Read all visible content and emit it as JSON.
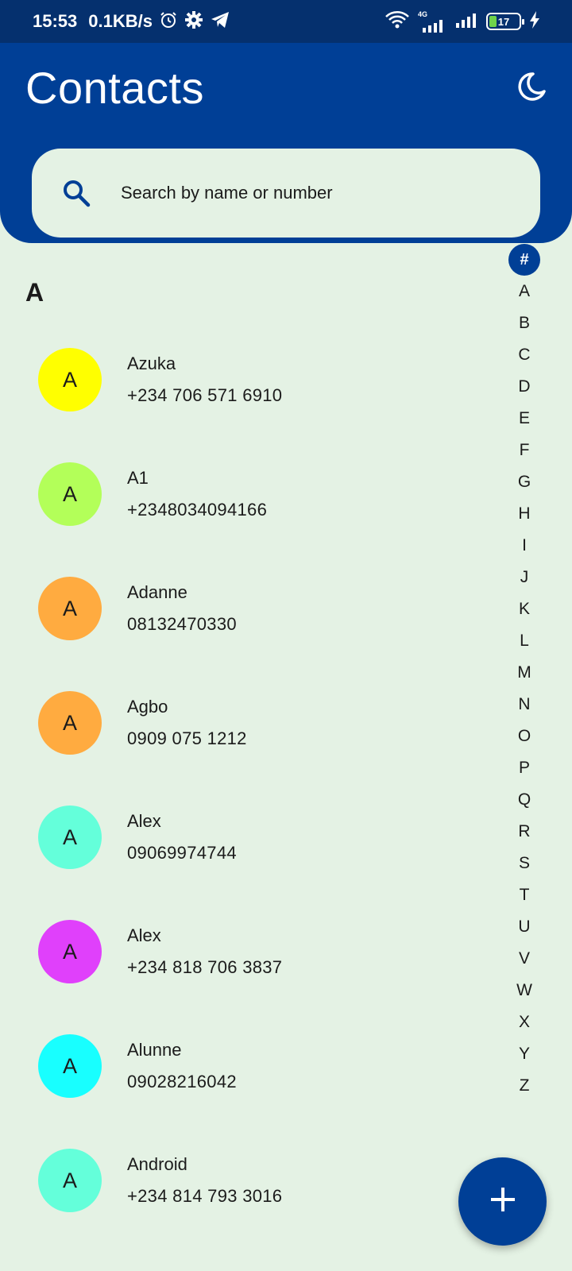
{
  "status_bar": {
    "time": "15:53",
    "speed": "0.1KB/s",
    "network_type": "4G",
    "battery": "17"
  },
  "header": {
    "title": "Contacts",
    "theme_icon": "moon-icon"
  },
  "search": {
    "placeholder": "Search by name or number",
    "icon": "search-icon"
  },
  "section": {
    "letter": "A"
  },
  "contacts": [
    {
      "initial": "A",
      "name": "Azuka",
      "phone": "+234 706 571 6910",
      "color": "#ffff00"
    },
    {
      "initial": "A",
      "name": "A1",
      "phone": "+2348034094166",
      "color": "#b3ff59"
    },
    {
      "initial": "A",
      "name": "Adanne",
      "phone": "08132470330",
      "color": "#ffab40"
    },
    {
      "initial": "A",
      "name": "Agbo",
      "phone": "0909 075 1212",
      "color": "#ffab40"
    },
    {
      "initial": "A",
      "name": "Alex",
      "phone": "09069974744",
      "color": "#64ffda"
    },
    {
      "initial": "A",
      "name": "Alex",
      "phone": "+234 818 706 3837",
      "color": "#e040fb"
    },
    {
      "initial": "A",
      "name": "Alunne",
      "phone": "09028216042",
      "color": "#18ffff"
    },
    {
      "initial": "A",
      "name": "Android",
      "phone": "+234 814 793 3016",
      "color": "#64ffda"
    }
  ],
  "alphabet_index": [
    "#",
    "A",
    "B",
    "C",
    "D",
    "E",
    "F",
    "G",
    "H",
    "I",
    "J",
    "K",
    "L",
    "M",
    "N",
    "O",
    "P",
    "Q",
    "R",
    "S",
    "T",
    "U",
    "V",
    "W",
    "X",
    "Y",
    "Z"
  ],
  "alphabet_active": "#",
  "fab": {
    "icon": "plus-icon"
  },
  "colors": {
    "primary": "#003f96",
    "status_bar": "#05306e",
    "background": "#e4f2e4"
  }
}
